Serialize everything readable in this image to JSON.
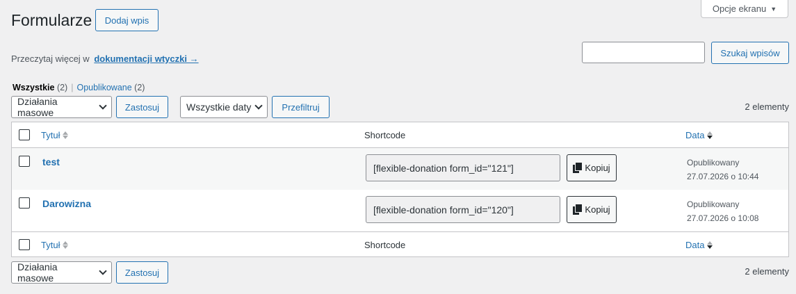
{
  "screen_options": {
    "label": "Opcje ekranu"
  },
  "header": {
    "title": "Formularze",
    "add_button": "Dodaj wpis"
  },
  "doc": {
    "text": "Przeczytaj więcej w",
    "link": "dokumentacji wtyczki →"
  },
  "search": {
    "button": "Szukaj wpisów",
    "value": ""
  },
  "views": [
    {
      "label": "Wszystkie",
      "count": "(2)"
    },
    {
      "label": "Opublikowane",
      "count": "(2)"
    }
  ],
  "top_nav": {
    "bulk_actions": "Działania masowe",
    "apply": "Zastosuj",
    "dates": "Wszystkie daty",
    "filter": "Przefiltruj",
    "count": "2 elementy"
  },
  "table": {
    "columns": {
      "title": "Tytuł",
      "shortcode": "Shortcode",
      "date": "Data"
    },
    "rows": [
      {
        "title": "test",
        "shortcode": "[flexible-donation form_id=\"121\"]",
        "copy": "Kopiuj",
        "status": "Opublikowany",
        "date": "27.07.2026 o 10:44"
      },
      {
        "title": "Darowizna",
        "shortcode": "[flexible-donation form_id=\"120\"]",
        "copy": "Kopiuj",
        "status": "Opublikowany",
        "date": "27.07.2026 o 10:08"
      }
    ]
  },
  "bottom_nav": {
    "bulk_actions": "Działania masowe",
    "apply": "Zastosuj",
    "count": "2 elementy"
  },
  "colors": {
    "accent": "#2271b1",
    "background": "#f0f0f1",
    "border": "#c3c4c7"
  }
}
